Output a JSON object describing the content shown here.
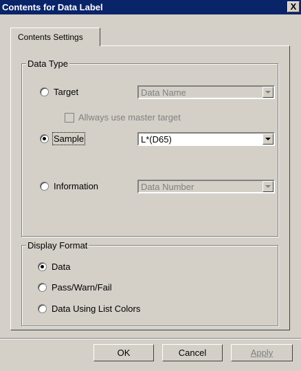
{
  "window": {
    "title": "Contents for Data Label",
    "close_glyph": "X"
  },
  "tabs": [
    {
      "label": "Contents Settings",
      "active": true
    }
  ],
  "data_type": {
    "legend": "Data Type",
    "target": {
      "label": "Target",
      "selected": false,
      "combo_value": "Data Name"
    },
    "always_master": {
      "label": "Allways use master target",
      "checked": false
    },
    "sample": {
      "label": "Sample",
      "selected": true,
      "combo_value": "L*(D65)"
    },
    "information": {
      "label": "Information",
      "selected": false,
      "combo_value": "Data Number"
    }
  },
  "display_format": {
    "legend": "Display Format",
    "options": [
      {
        "label": "Data",
        "selected": true
      },
      {
        "label": "Pass/Warn/Fail",
        "selected": false
      },
      {
        "label": "Data Using List Colors",
        "selected": false
      }
    ]
  },
  "buttons": {
    "ok": "OK",
    "cancel": "Cancel",
    "apply": "Apply"
  }
}
